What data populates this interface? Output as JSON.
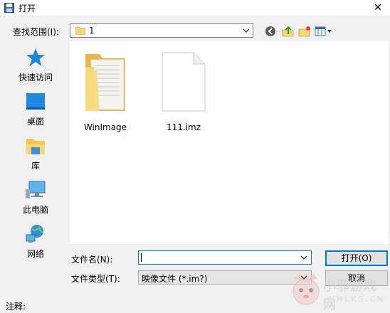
{
  "window": {
    "title": "打开"
  },
  "lookin": {
    "label": "查找范围(I):",
    "value": "1"
  },
  "toolbar": {
    "back_icon": "back-icon",
    "up_icon": "up-folder-icon",
    "newfolder_icon": "new-folder-icon",
    "view_icon": "view-menu-icon"
  },
  "places": [
    {
      "label": "快速访问",
      "icon": "star-icon"
    },
    {
      "label": "桌面",
      "icon": "desktop-icon"
    },
    {
      "label": "库",
      "icon": "library-icon"
    },
    {
      "label": "此电脑",
      "icon": "computer-icon"
    },
    {
      "label": "网络",
      "icon": "network-icon"
    }
  ],
  "files": [
    {
      "name": "WinImage",
      "icon": "folder-icon"
    },
    {
      "name": "111.imz",
      "icon": "file-icon"
    }
  ],
  "filename": {
    "label": "文件名(N):",
    "value": ""
  },
  "filetype": {
    "label": "文件类型(T):",
    "value": "映像文件 (*.im?)"
  },
  "buttons": {
    "open": "打开(O)",
    "cancel": "取消"
  },
  "comment": {
    "label": "注释:"
  },
  "watermark": {
    "text": "小邪游戏网",
    "sub": "XHLKS.CN"
  }
}
